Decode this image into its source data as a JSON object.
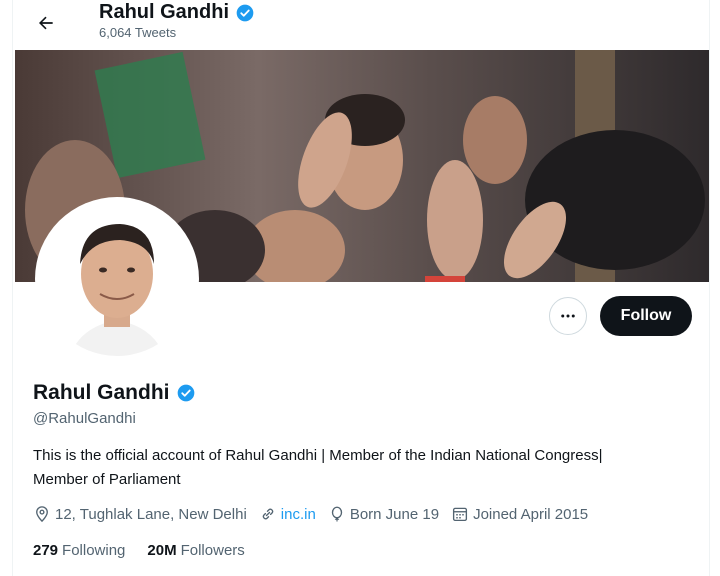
{
  "header": {
    "title": "Rahul Gandhi",
    "tweet_count": "6,064 Tweets"
  },
  "profile": {
    "name": "Rahul Gandhi",
    "handle": "@RahulGandhi",
    "bio": "This is the official account of Rahul Gandhi | Member of the Indian National Congress| Member of Parliament",
    "location": "12, Tughlak Lane, New Delhi",
    "website": "inc.in",
    "birthday": "Born June 19",
    "joined": "Joined April 2015",
    "following_count": "279",
    "following_label": "Following",
    "followers_count": "20M",
    "followers_label": "Followers"
  },
  "actions": {
    "more_icon": "more-icon",
    "follow_label": "Follow"
  },
  "colors": {
    "accent": "#1d9bf0",
    "primary_text": "#0f1419",
    "secondary_text": "#536471",
    "button_dark": "#0f1419"
  }
}
